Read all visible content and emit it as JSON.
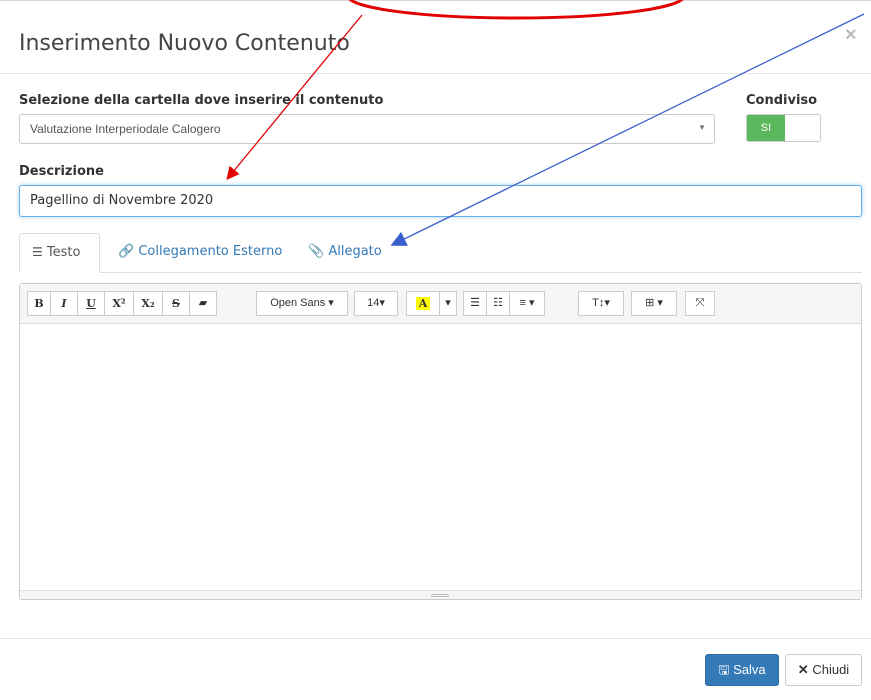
{
  "modal": {
    "title": "Inserimento Nuovo Contenuto",
    "close_glyph": "×"
  },
  "folder": {
    "label": "Selezione della cartella dove inserire il contenuto",
    "value": "Valutazione Interperiodale Calogero"
  },
  "shared": {
    "label": "Condiviso",
    "toggle_on": "SI"
  },
  "description": {
    "label": "Descrizione",
    "value": "Pagellino di Novembre 2020"
  },
  "tabs": [
    {
      "label": "Testo",
      "icon": "align-left-icon"
    },
    {
      "label": "Collegamento Esterno",
      "icon": "link-icon"
    },
    {
      "label": "Allegato",
      "icon": "paperclip-icon"
    }
  ],
  "toolbar": {
    "bold": "B",
    "italic": "I",
    "underline": "U",
    "superscript": "X²",
    "subscript": "X₂",
    "strikethrough": "S",
    "eraser": "▰",
    "font_name": "Open Sans ▾",
    "font_size": "14▾",
    "color_letter": "A",
    "caret": "▾",
    "ul": "☰",
    "ol": "☷",
    "align": "≡ ▾",
    "height": "T↕▾",
    "table": "⊞ ▾",
    "fullscreen": "⤧"
  },
  "footer": {
    "save": "Salva",
    "close": "Chiudi"
  },
  "colors": {
    "primary": "#337ab7",
    "success": "#5cb85c",
    "annotation_red": "#e00000",
    "annotation_blue": "#3a5fcd",
    "highlight": "#ffff00"
  }
}
